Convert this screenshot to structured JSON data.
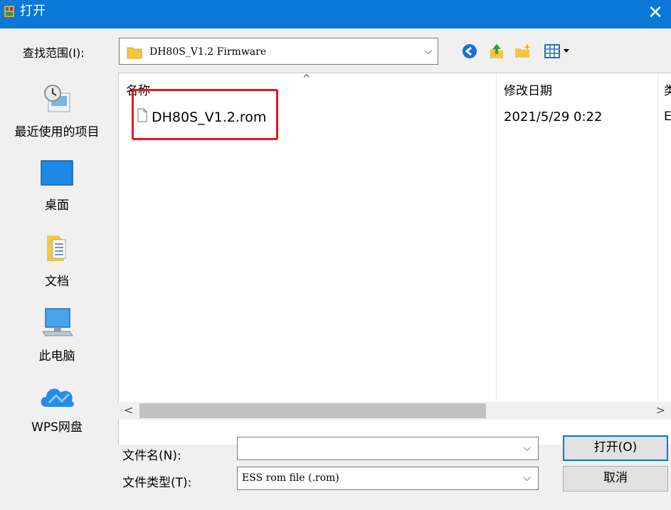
{
  "window": {
    "title": "打开",
    "close_glyph": "✕"
  },
  "lookin": {
    "label": "查找范围(I):",
    "value": "DH80S_V1.2 Firmware",
    "chevron": "⌵"
  },
  "toolbar": {
    "icons": [
      "back-icon",
      "up-folder-icon",
      "new-folder-icon",
      "view-menu-icon"
    ]
  },
  "places": [
    {
      "label": "最近使用的项目",
      "icon": "recent-items-icon"
    },
    {
      "label": "桌面",
      "icon": "desktop-icon"
    },
    {
      "label": "文档",
      "icon": "documents-icon"
    },
    {
      "label": "此电脑",
      "icon": "this-pc-icon"
    },
    {
      "label": "WPS网盘",
      "icon": "wps-cloud-icon"
    }
  ],
  "filelist": {
    "columns": {
      "name": "名称",
      "modified": "修改日期",
      "partial": "类"
    },
    "sort_glyph": "^",
    "rows": [
      {
        "name": "DH80S_V1.2.rom",
        "modified": "2021/5/29 0:22",
        "partial": "E"
      }
    ]
  },
  "scroll": {
    "left": "<",
    "right": ">"
  },
  "filename": {
    "label": "文件名(N):",
    "value": "",
    "chevron": "⌵"
  },
  "filetype": {
    "label": "文件类型(T):",
    "value": "ESS rom file (.rom)",
    "chevron": "⌵"
  },
  "buttons": {
    "open": "打开(O)",
    "cancel": "取消"
  },
  "colors": {
    "titlebar": "#0a78d7",
    "highlight": "#e8181b",
    "dialog_bg": "#f0f0f0"
  }
}
